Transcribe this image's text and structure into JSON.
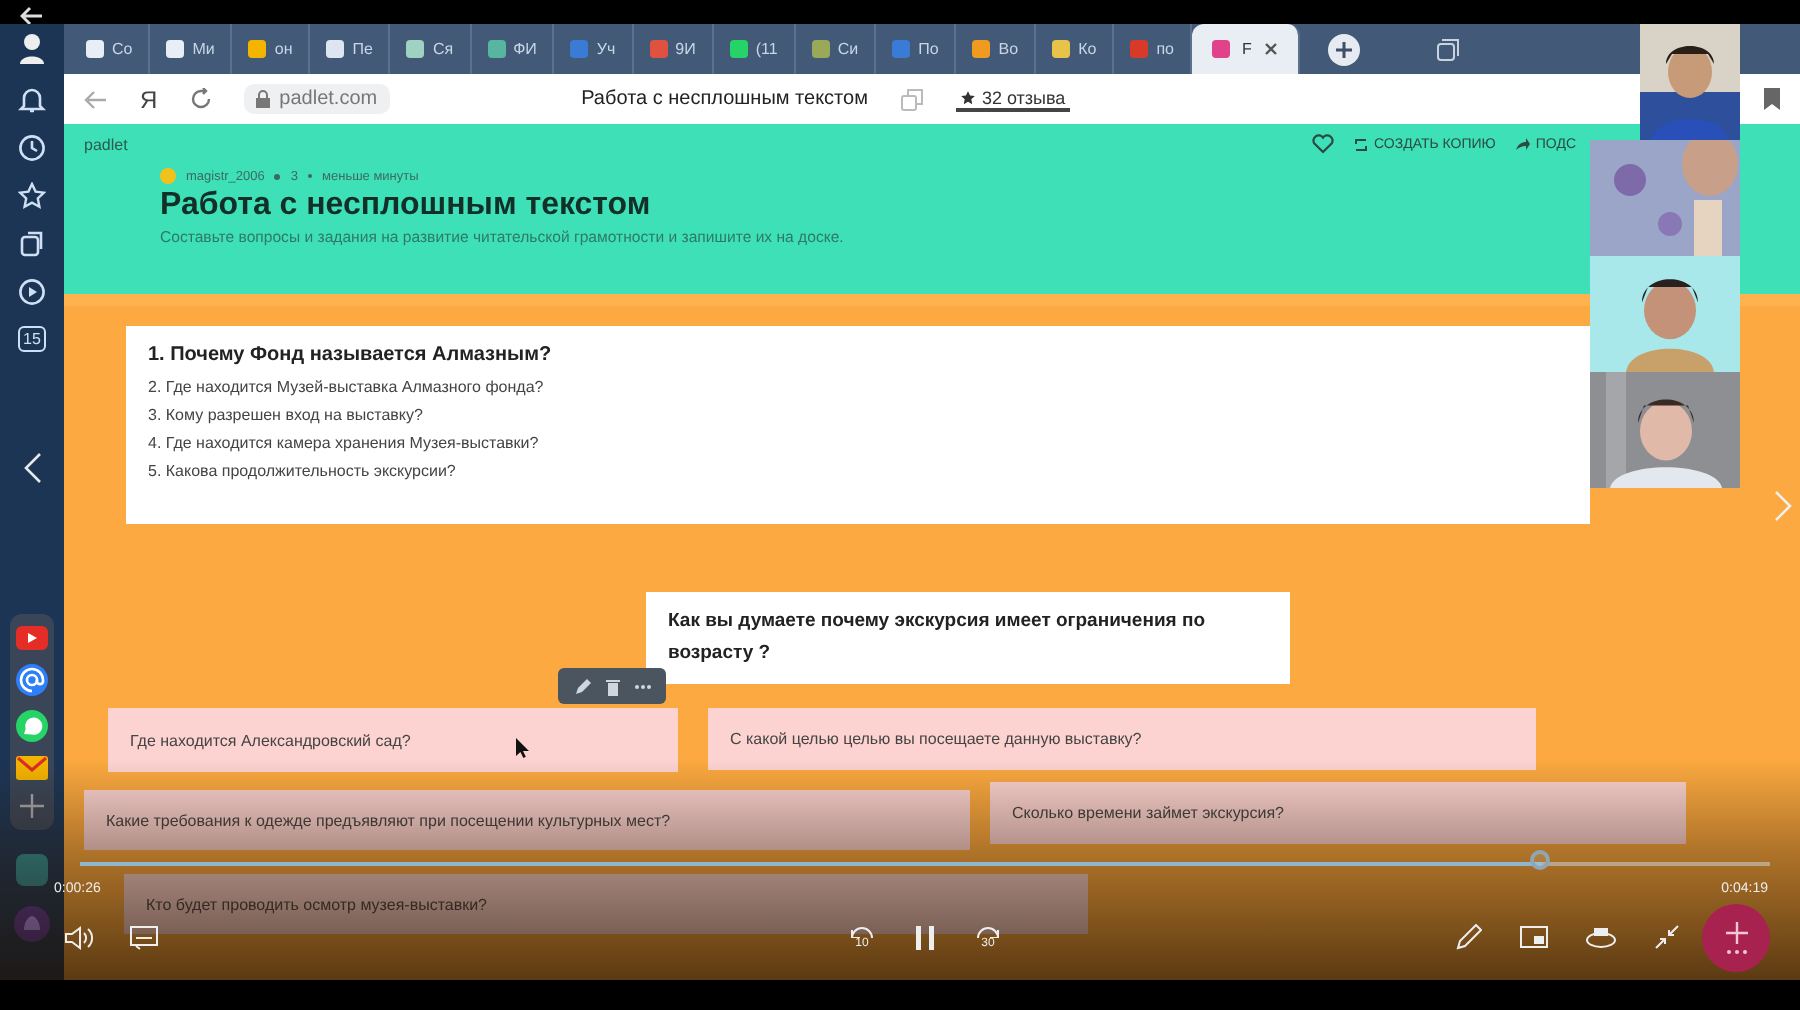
{
  "os_sidebar": {
    "calendar_day": "15"
  },
  "browser": {
    "tabs": [
      {
        "label": "Со",
        "selected": false
      },
      {
        "label": "Ми",
        "selected": false
      },
      {
        "label": "он",
        "selected": false
      },
      {
        "label": "Пе",
        "selected": false
      },
      {
        "label": "Ся",
        "selected": false
      },
      {
        "label": "ФИ",
        "selected": false
      },
      {
        "label": "Уч",
        "selected": false
      },
      {
        "label": "9И",
        "selected": false
      },
      {
        "label": "(11",
        "selected": false
      },
      {
        "label": "Си",
        "selected": false
      },
      {
        "label": "По",
        "selected": false
      },
      {
        "label": "Во",
        "selected": false
      },
      {
        "label": "Ко",
        "selected": false
      },
      {
        "label": "по",
        "selected": false
      },
      {
        "label": "F",
        "selected": true
      }
    ],
    "home_glyph": "Я",
    "address": "padlet.com",
    "page_title": "Работа с несплошным текстом",
    "reviews": "32 отзыва"
  },
  "padlet": {
    "brand": "padlet",
    "actions": [
      "СОЗДАТЬ КОПИЮ",
      "ПОДС"
    ],
    "author": "magistr_2006",
    "likes": "3",
    "time": "меньше минуты",
    "title": "Работа с несплошным текстом",
    "description": "Составьте вопросы и задания на развитие читательской грамотности и запишите их на доске."
  },
  "cards": [
    {
      "kind": "list",
      "title": "1. Почему Фонд называется Алмазным?",
      "items": [
        "2. Где находится Музей-выставка Алмазного фонда?",
        "3. Кому разрешен вход на выставку?",
        "4. Где находится камера хранения Музея-выставки?",
        "5. Какова продолжительность экскурсии?"
      ]
    },
    {
      "kind": "note",
      "text": "Как вы думаете почему экскурсия имеет ограничения по возрасту ?"
    },
    {
      "kind": "pink",
      "text": "Где находится Александровский сад?"
    },
    {
      "kind": "pink",
      "text": "С какой целью целью вы посещаете данную выставку?"
    },
    {
      "kind": "pink",
      "text": "Какие требования к одежде предъявляют  при посещении культурных мест?"
    },
    {
      "kind": "pink",
      "text": "Сколько времени займет экскурсия?"
    },
    {
      "kind": "pink",
      "text": "Кто будет проводить осмотр музея-выставки?"
    }
  ],
  "video_player": {
    "elapsed": "0:00:26",
    "total": "0:04:19",
    "level": 0.865,
    "rewind": "10",
    "forward": "30"
  }
}
